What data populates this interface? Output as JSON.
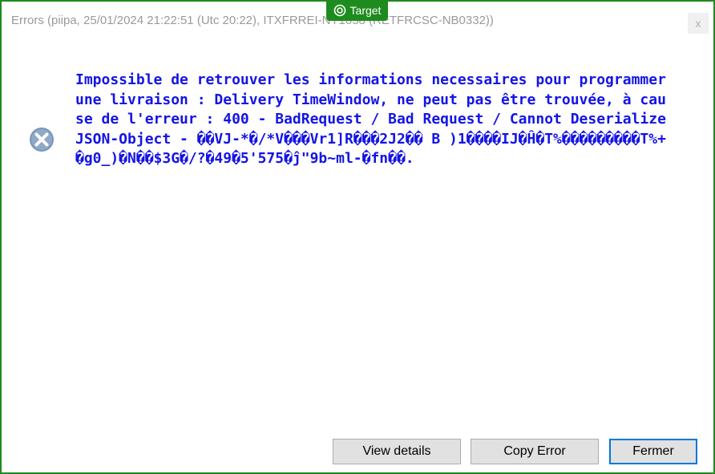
{
  "window": {
    "title": "Errors (piipa, 25/01/2024 21:22:51 (Utc 20:22), ITXFRREI-NY1058 (RETFRCSC-NB0332))",
    "close_glyph": "x"
  },
  "badge": {
    "label": "Target",
    "icon": "target-icon",
    "color": "#1e8b1e"
  },
  "error": {
    "icon": "error-x-icon",
    "message": "Impossible de retrouver les informations necessaires pour programmer une livraison : Delivery TimeWindow, ne peut pas être trouvée, à cause de l'erreur : 400 - BadRequest / Bad Request / Cannot Deserialize JSON-Object - ��VJ-*�/*V���Vr1]R���2J2�� B )1����IJ�Ĥ�T%���������T%+�g0_)�N��$3G�/?�49�5'575�ĵ\"9b~ml-�fn��.",
    "message_color": "#1414e6"
  },
  "buttons": {
    "view_details": "View details",
    "copy_error": "Copy Error",
    "close": "Fermer"
  },
  "colors": {
    "frame_border": "#1f8a1f",
    "default_button_border": "#0078d7"
  }
}
